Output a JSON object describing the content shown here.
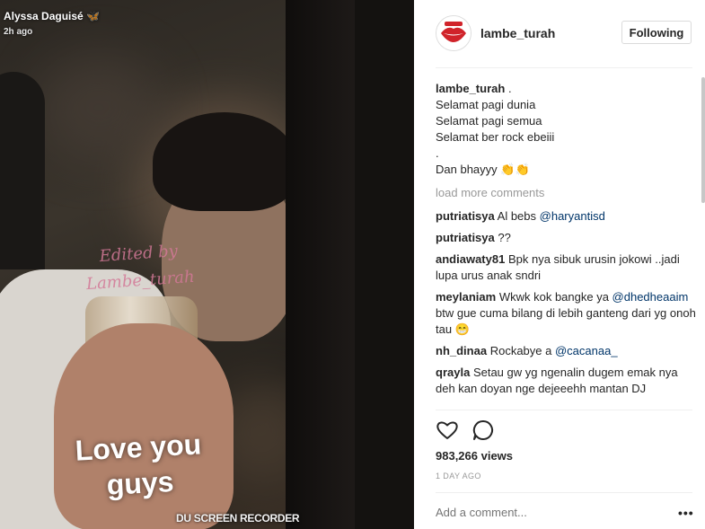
{
  "media": {
    "poster_name": "Alyssa Daguisé",
    "poster_heart": "🦋",
    "time_ago": "2h ago",
    "watermark_line1": "Edited by",
    "watermark_line2": "Lambe_turah",
    "caption_line1": "Love you",
    "caption_line2": "guys",
    "recorder_label": "DU SCREEN RECORDER"
  },
  "header": {
    "username": "lambe_turah",
    "follow_label": "Following",
    "avatar_icon": "lips-logo-icon"
  },
  "post": {
    "author": "lambe_turah",
    "caption_lines": [
      ". ",
      "Selamat pagi dunia",
      "Selamat pagi semua",
      "Selamat ber rock ebeiii",
      ".",
      "Dan bhayyy 👏👏"
    ]
  },
  "load_more": "load more comments",
  "comments": [
    {
      "user": "putriatisya",
      "text": "Al bebs ",
      "mention": "@haryantisd",
      "after": ""
    },
    {
      "user": "putriatisya",
      "text": "??",
      "mention": "",
      "after": ""
    },
    {
      "user": "andiawaty81",
      "text": "Bpk nya sibuk urusin jokowi ..jadi lupa urus anak sndri",
      "mention": "",
      "after": ""
    },
    {
      "user": "meylaniam",
      "text": "Wkwk kok bangke ya ",
      "mention": "@dhedheaaim",
      "after": " btw gue cuma bilang di lebih ganteng dari yg onoh tau 😁"
    },
    {
      "user": "nh_dinaa",
      "text": "Rockabye a ",
      "mention": "@cacanaa_",
      "after": ""
    },
    {
      "user": "qrayla",
      "text": "Setau gw yg ngenalin dugem emak nya deh kan doyan nge dejeeehh mantan DJ",
      "mention": "",
      "after": ""
    }
  ],
  "views": "983,266 views",
  "date": "1 DAY AGO",
  "add_comment_placeholder": "Add a comment...",
  "more_label": "•••",
  "icons": {
    "like": "heart-icon",
    "comment": "comment-icon"
  },
  "colors": {
    "link": "#003569",
    "muted": "#999999",
    "text": "#262626"
  }
}
